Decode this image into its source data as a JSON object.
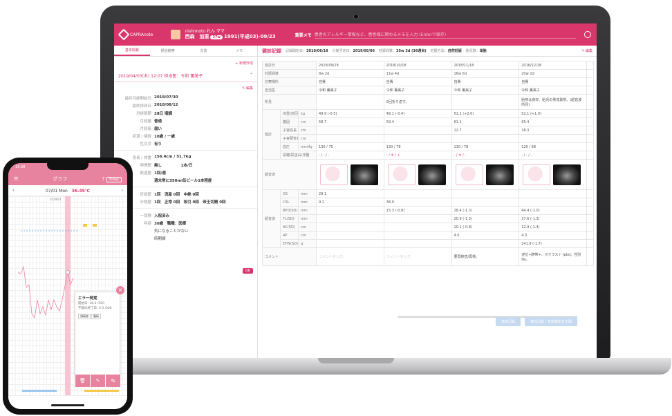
{
  "laptop": {
    "header": {
      "app_name": "CAPRAnote",
      "patient_kana": "nishimoto れん ママ",
      "patient_name": "西森　加恵",
      "week_badge": "37w",
      "patient_dob": "1991(平成03)-09/23",
      "memo_label": "重要メモ",
      "memo_placeholder": "患者のアレルギー情報など、患者様に関わるメモを入力 (Enterで保存)"
    },
    "left": {
      "tabs": [
        "基本情報",
        "経過観察",
        "文書",
        "メモ"
      ],
      "new_record": "新規作成",
      "visit_header": "2019/04/03(木) 12:07 担当医：令和 薫美子",
      "edit": "編集",
      "rows": [
        {
          "k": "最終月経開始日",
          "v": "2018/07/30"
        },
        {
          "k": "最終排卵日",
          "v": "2018/08/12"
        },
        {
          "k": "月経周期",
          "v": "28日 順調"
        },
        {
          "k": "月経量",
          "v": "普通"
        },
        {
          "k": "月経痛",
          "v": "弱い"
        },
        {
          "k": "初潮 / 閉経",
          "v": "10歳 / 一歳"
        },
        {
          "k": "性交渉",
          "v": "有り"
        }
      ],
      "rows2": [
        {
          "k": "身長 / 体重",
          "v": "156.4cm / 51.7kg"
        },
        {
          "k": "喫煙歴",
          "v": "無し　　　　　1本/日"
        },
        {
          "k": "飲酒歴",
          "v": "1回/週"
        },
        {
          "k": "",
          "v": "週末常に350ml缶ビール1本程度"
        }
      ],
      "rows3": [
        {
          "k": "妊娠歴",
          "v": "1回　流産 0回　中絶 0回"
        },
        {
          "k": "分娩歴",
          "v": "1回　正常 0回　吸引 0回　帝王切開 0回"
        }
      ],
      "rows4": [
        {
          "k": "ー保険",
          "v": "入院済み"
        },
        {
          "k": "年齢",
          "v": "30歳　職種：医療"
        }
      ],
      "notes": [
        "気になることがない",
        "時期間"
      ],
      "pink_btn": "OK"
    },
    "right": {
      "title": "健診記録",
      "meta": [
        {
          "k": "記録開始日：",
          "v": "2018/06/18"
        },
        {
          "k": "分娩予定日：",
          "v": "2019/05/06"
        },
        {
          "k": "妊娠週数：",
          "v": "35w 3d (36週目)"
        },
        {
          "k": "妊娠方法：",
          "v": "自然妊娠"
        },
        {
          "k": "胎児数：",
          "v": "単胎"
        }
      ],
      "edit": "編集",
      "dates": [
        "2018/09/18",
        "2018/10/18",
        "2018/11/18",
        "2018/12/18"
      ],
      "weeks": [
        "8w 2d",
        "11w 4d",
        "16w 0d",
        "20w 2d"
      ],
      "location": [
        "自費",
        "自費",
        "自費",
        "自費"
      ],
      "doctor": [
        "令和 薫美子",
        "令和 薫美子",
        "令和 薫美子",
        "令和 薫美子"
      ],
      "notes": [
        "",
        "8回折り返す。",
        "",
        "胎芽は良好、胎児の発達異常。(超音波所見)"
      ],
      "weight": [
        [
          "49.9",
          "(-0.5)"
        ],
        [
          "49.1",
          "(-0.4)"
        ],
        [
          "51.1",
          "(+2.0)"
        ],
        [
          "52.1",
          "(+1.0)"
        ]
      ],
      "abdomen": [
        "58.7",
        "59.4",
        "61.1",
        "65.4"
      ],
      "fundus": [
        "",
        "",
        "12.7",
        "18.3"
      ],
      "bp": [
        [
          "130",
          "75"
        ],
        [
          "130",
          "78"
        ],
        [
          "130",
          "78"
        ],
        [
          "125",
          "68"
        ]
      ],
      "urine": [
        "- / - / -",
        "- / ± / +",
        "- / ± / -",
        "- / - / -"
      ],
      "gs": "29.1",
      "crl": [
        "9.1",
        "38.0"
      ],
      "bpd": [
        [
          "",
          ""
        ],
        [
          "15.3",
          "(-0.8)"
        ],
        [
          "28.4",
          "(-1.3)"
        ],
        [
          "44.4",
          "(-1.0)"
        ]
      ],
      "fl": [
        "",
        "",
        "20.9 (-1.3)",
        "27.6 (-1.3)"
      ],
      "ac": [
        "",
        "",
        "10.1 (-0.8)",
        "12.9 (-1.4)"
      ],
      "ap": [
        "",
        "",
        "4.0",
        "4.3"
      ],
      "efw": [
        "",
        "",
        "",
        "241.9 (-1.7)"
      ],
      "comments": [
        "コメントを入力",
        "コメントを入力",
        "要再検査/再検。",
        "逆位+臍帯+。ボクラスト Ipbd。性別No。"
      ],
      "labels": {
        "date": "受診日",
        "week": "妊娠週数",
        "place": "診察場所",
        "doctor": "担当医",
        "note": "所見",
        "weight": "体重(前回比)",
        "abdomen": "腹囲",
        "fundus": "子宮底長",
        "fundus2": "子宮頸管長",
        "bp": "血圧",
        "urine": "尿糖/尿蛋白/浮腫",
        "us": "超音波",
        "gs": "GS",
        "crl": "CRL",
        "bpd": "BPD(SD)",
        "fl": "FL(SD)",
        "ac": "AC(SD)",
        "ap": "AP",
        "efw": "EFW(SD)",
        "comment": "コメント",
        "section": "健診",
        "section2": "超音波"
      },
      "units": {
        "kg": "kg",
        "cm": "cm",
        "mmhg": "mmHg",
        "mm": "mm",
        "g": "g"
      },
      "buttons": [
        "検査記録",
        "検診記録 / 身体測定を印刷"
      ]
    }
  },
  "phone": {
    "time": "19:38",
    "title": "グラフ",
    "today": "Today",
    "date": "07/01 Mon",
    "temp": "36.45℃",
    "month": "2019/07",
    "popup_title": "エラー発覚",
    "popup_lines": [
      "開始日: 18.4 /300",
      "不順の終了日: 0.3 /300"
    ],
    "chips": [
      "頭痛感",
      "腹痛"
    ],
    "actions": [
      "🗑",
      "✎",
      "⇆"
    ]
  }
}
